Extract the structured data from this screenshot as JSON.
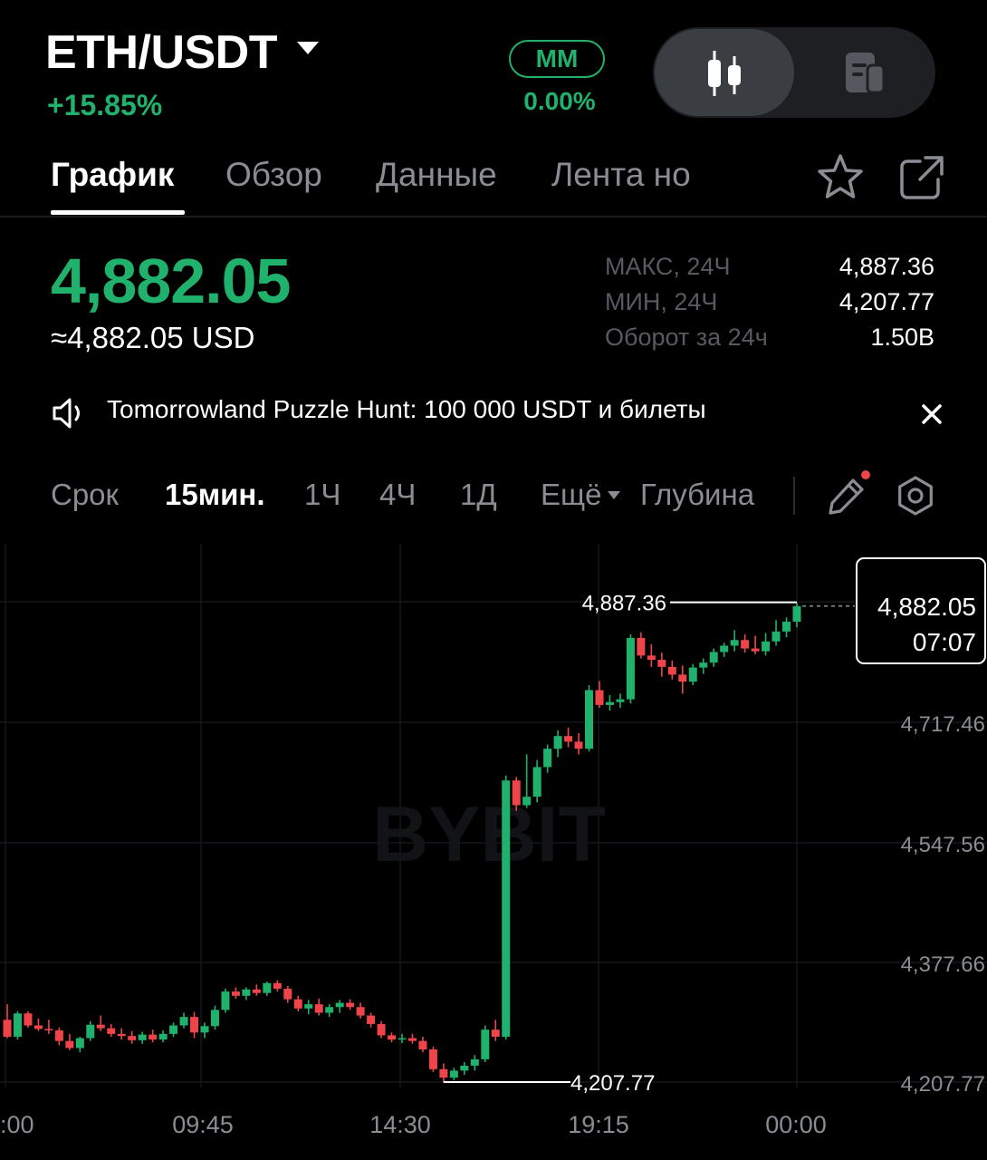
{
  "header": {
    "pair": "ETH/USDT",
    "change": "+15.85%",
    "mm_label": "MM",
    "mm_value": "0.00%"
  },
  "tabs": [
    {
      "label": "График",
      "active": true
    },
    {
      "label": "Обзор",
      "active": false
    },
    {
      "label": "Данные",
      "active": false
    },
    {
      "label": "Лента но",
      "active": false
    }
  ],
  "price": {
    "last": "4,882.05",
    "usd": "≈4,882.05 USD",
    "stats": [
      {
        "label": "МАКС, 24Ч",
        "value": "4,887.36"
      },
      {
        "label": "МИН, 24Ч",
        "value": "4,207.77"
      },
      {
        "label": "Оборот за 24ч",
        "value": "1.50B"
      }
    ]
  },
  "announcement": {
    "text": "Tomorrowland Puzzle Hunt: 100 000 USDT и билеты"
  },
  "intervals": {
    "items": [
      "Срок",
      "15мин.",
      "1Ч",
      "4Ч",
      "1Д",
      "Ещё"
    ],
    "active": "15мин.",
    "depth_label": "Глубина"
  },
  "colors": {
    "up": "#20b26c",
    "down": "#ef454a",
    "background": "#000000"
  },
  "icons": {
    "pair_dropdown": "caret-down-icon",
    "candle_view": "candlestick-icon",
    "list_view": "document-list-icon",
    "favorite": "star-icon",
    "share": "external-link-icon",
    "announcement": "speaker-icon",
    "close": "close-icon",
    "draw": "pencil-icon",
    "settings": "hexagon-settings-icon"
  },
  "chart_data": {
    "type": "candlestick",
    "watermark": "BYBIT",
    "y_ticks": [
      "4,717.46",
      "4,547.56",
      "4,377.66",
      "4,207.77"
    ],
    "x_ticks": [
      ":00",
      "09:45",
      "14:30",
      "19:15",
      "00:00"
    ],
    "ylim": [
      4190,
      4900
    ],
    "high_marker": "4,887.36",
    "low_marker": "4,207.77",
    "last_price": "4,882.05",
    "countdown": "07:07",
    "grid": true,
    "candles": [
      [
        4296,
        4318,
        4270,
        4272
      ],
      [
        4272,
        4308,
        4268,
        4305
      ],
      [
        4305,
        4308,
        4285,
        4288
      ],
      [
        4288,
        4298,
        4280,
        4283
      ],
      [
        4283,
        4296,
        4276,
        4281
      ],
      [
        4281,
        4285,
        4260,
        4266
      ],
      [
        4266,
        4276,
        4253,
        4256
      ],
      [
        4256,
        4272,
        4250,
        4270
      ],
      [
        4270,
        4294,
        4266,
        4289
      ],
      [
        4289,
        4302,
        4280,
        4284
      ],
      [
        4284,
        4290,
        4272,
        4276
      ],
      [
        4276,
        4284,
        4268,
        4273
      ],
      [
        4273,
        4280,
        4262,
        4267
      ],
      [
        4267,
        4279,
        4262,
        4275
      ],
      [
        4275,
        4282,
        4264,
        4268
      ],
      [
        4268,
        4281,
        4264,
        4276
      ],
      [
        4276,
        4292,
        4272,
        4288
      ],
      [
        4288,
        4306,
        4284,
        4300
      ],
      [
        4300,
        4307,
        4270,
        4278
      ],
      [
        4278,
        4292,
        4270,
        4287
      ],
      [
        4287,
        4316,
        4282,
        4310
      ],
      [
        4310,
        4340,
        4306,
        4336
      ],
      [
        4336,
        4342,
        4326,
        4330
      ],
      [
        4330,
        4342,
        4324,
        4339
      ],
      [
        4339,
        4346,
        4330,
        4334
      ],
      [
        4334,
        4350,
        4330,
        4348
      ],
      [
        4348,
        4352,
        4336,
        4340
      ],
      [
        4340,
        4344,
        4320,
        4325
      ],
      [
        4325,
        4330,
        4308,
        4312
      ],
      [
        4312,
        4324,
        4304,
        4318
      ],
      [
        4318,
        4326,
        4302,
        4306
      ],
      [
        4306,
        4318,
        4300,
        4314
      ],
      [
        4314,
        4324,
        4306,
        4320
      ],
      [
        4320,
        4325,
        4310,
        4314
      ],
      [
        4314,
        4320,
        4298,
        4302
      ],
      [
        4302,
        4306,
        4285,
        4290
      ],
      [
        4290,
        4294,
        4270,
        4274
      ],
      [
        4274,
        4278,
        4264,
        4268
      ],
      [
        4268,
        4276,
        4263,
        4270
      ],
      [
        4270,
        4276,
        4262,
        4266
      ],
      [
        4266,
        4272,
        4250,
        4254
      ],
      [
        4254,
        4258,
        4222,
        4226
      ],
      [
        4226,
        4234,
        4207,
        4214
      ],
      [
        4214,
        4228,
        4210,
        4224
      ],
      [
        4224,
        4236,
        4218,
        4231
      ],
      [
        4231,
        4246,
        4224,
        4240
      ],
      [
        4240,
        4288,
        4236,
        4282
      ],
      [
        4282,
        4296,
        4266,
        4272
      ],
      [
        4272,
        4642,
        4268,
        4635
      ],
      [
        4635,
        4640,
        4592,
        4600
      ],
      [
        4600,
        4672,
        4596,
        4612
      ],
      [
        4612,
        4664,
        4604,
        4654
      ],
      [
        4654,
        4686,
        4646,
        4680
      ],
      [
        4680,
        4706,
        4668,
        4698
      ],
      [
        4698,
        4710,
        4682,
        4690
      ],
      [
        4690,
        4702,
        4672,
        4680
      ],
      [
        4680,
        4770,
        4676,
        4763
      ],
      [
        4763,
        4776,
        4738,
        4742
      ],
      [
        4742,
        4756,
        4734,
        4746
      ],
      [
        4746,
        4758,
        4738,
        4750
      ],
      [
        4750,
        4842,
        4744,
        4837
      ],
      [
        4837,
        4845,
        4808,
        4812
      ],
      [
        4812,
        4828,
        4796,
        4806
      ],
      [
        4806,
        4816,
        4782,
        4796
      ],
      [
        4796,
        4805,
        4778,
        4785
      ],
      [
        4785,
        4798,
        4758,
        4775
      ],
      [
        4775,
        4800,
        4770,
        4795
      ],
      [
        4795,
        4808,
        4786,
        4802
      ],
      [
        4802,
        4822,
        4796,
        4817
      ],
      [
        4817,
        4830,
        4810,
        4826
      ],
      [
        4826,
        4848,
        4818,
        4834
      ],
      [
        4834,
        4842,
        4816,
        4822
      ],
      [
        4822,
        4840,
        4814,
        4818
      ],
      [
        4818,
        4844,
        4812,
        4832
      ],
      [
        4832,
        4862,
        4826,
        4846
      ],
      [
        4846,
        4866,
        4838,
        4860
      ],
      [
        4860,
        4887,
        4852,
        4882
      ]
    ]
  }
}
